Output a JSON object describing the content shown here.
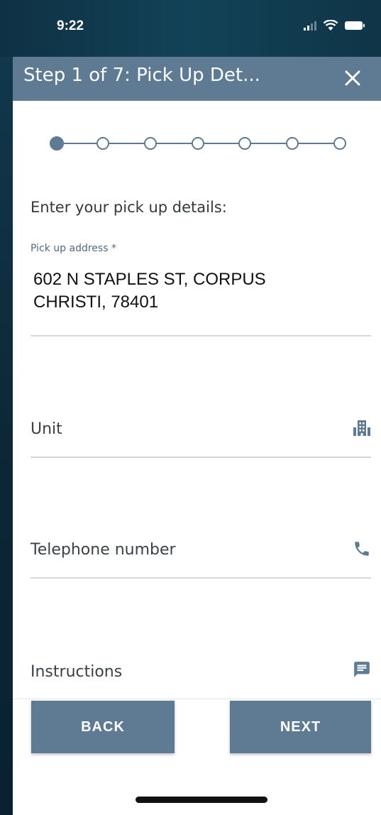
{
  "status_bar": {
    "time": "9:22",
    "icons": [
      "signal-icon",
      "wifi-icon",
      "battery-icon"
    ]
  },
  "header": {
    "title": "Step 1 of 7: Pick Up Det...",
    "close_icon": "close-icon",
    "background_color": "#5e7b93"
  },
  "stepper": {
    "total_steps": 7,
    "current_step": 1
  },
  "form": {
    "intro": "Enter your pick up details:",
    "pickup_address": {
      "label": "Pick up address *",
      "value": "602 N STAPLES ST, CORPUS CHRISTI, 78401"
    },
    "unit": {
      "placeholder": "Unit",
      "icon": "building-icon"
    },
    "telephone": {
      "placeholder": "Telephone number",
      "icon": "phone-icon"
    },
    "instructions": {
      "placeholder": "Instructions",
      "icon": "message-icon"
    }
  },
  "buttons": {
    "back_label": "BACK",
    "next_label": "NEXT"
  },
  "colors": {
    "accent": "#5e7b93",
    "label": "#4d6b86",
    "divider": "#d8d8d8"
  }
}
